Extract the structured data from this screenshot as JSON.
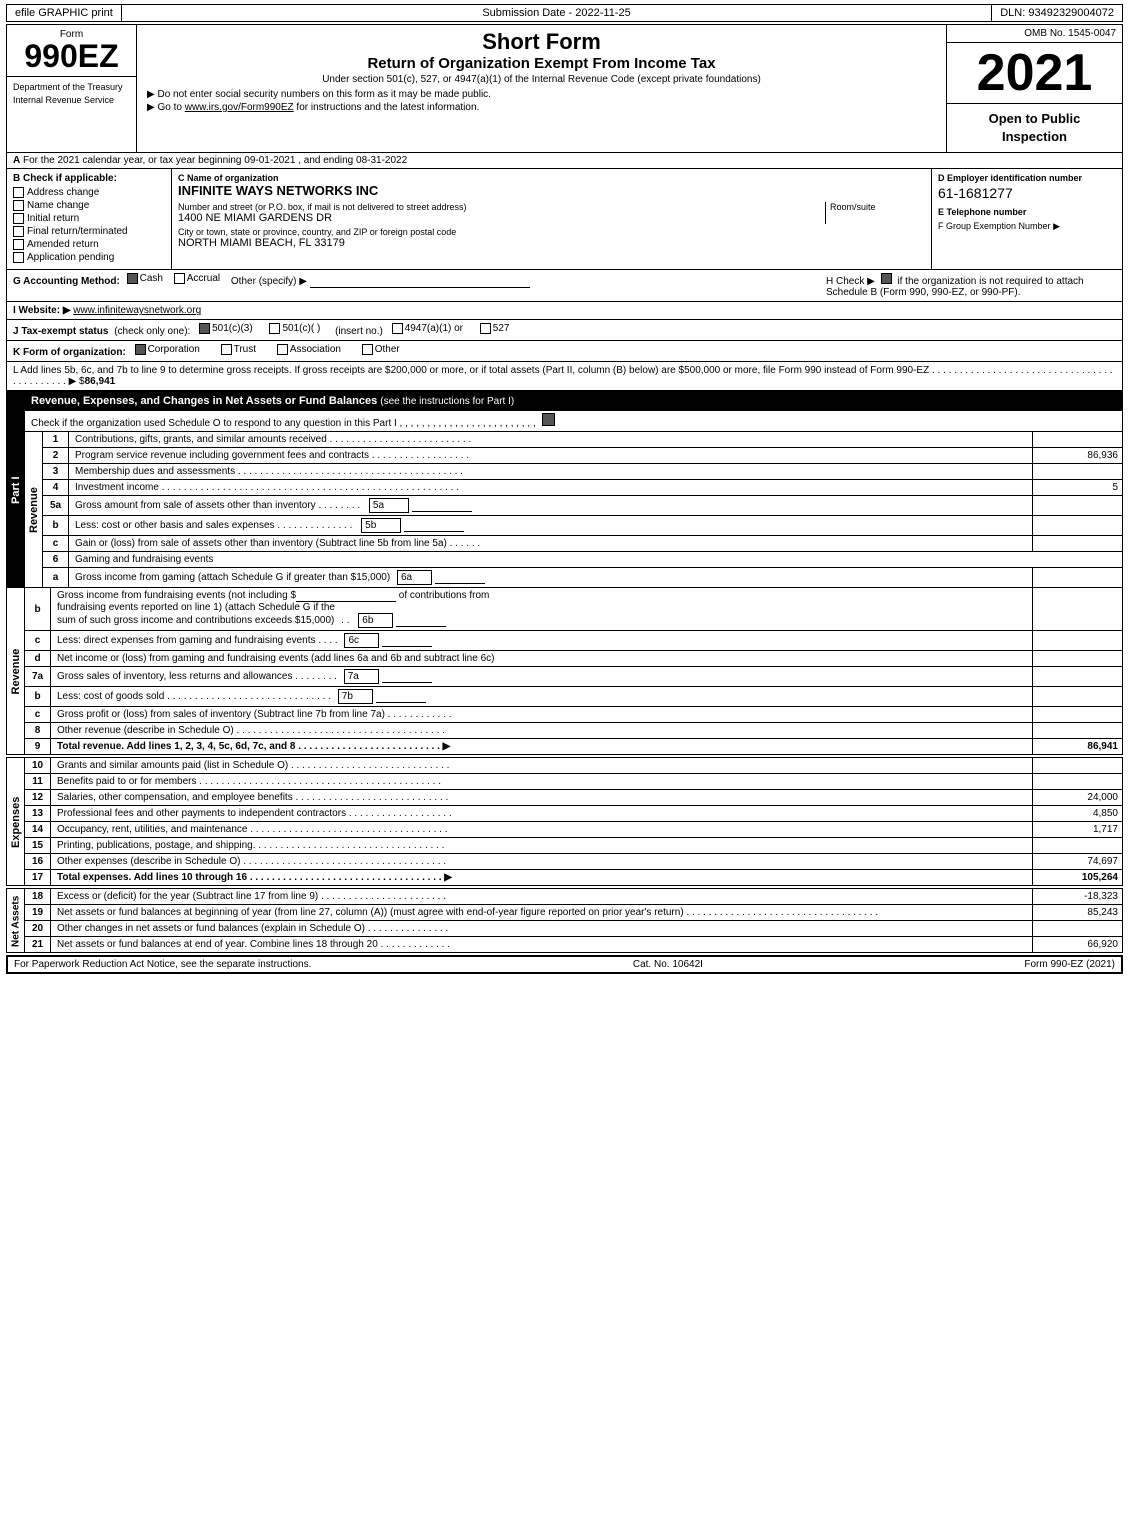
{
  "topBar": {
    "efile": "efile GRAPHIC print",
    "submissionLabel": "Submission Date - 2022-11-25",
    "dlnLabel": "DLN: 93492329004072"
  },
  "header": {
    "ombNo": "OMB No. 1545-0047",
    "formNumber": "990EZ",
    "formSub": "Form",
    "shortForm": "Short Form",
    "returnTitle": "Return of Organization Exempt From Income Tax",
    "subtitle": "Under section 501(c), 527, or 4947(a)(1) of the Internal Revenue Code (except private foundations)",
    "doNotEnter": "▶ Do not enter social security numbers on this form as it may be made public.",
    "goTo": "▶ Go to www.irs.gov/Form990EZ for instructions and the latest information.",
    "year": "2021",
    "openToPublic": "Open to Public Inspection",
    "deptLine1": "Department of the Treasury",
    "deptLine2": "Internal Revenue Service"
  },
  "sectionA": {
    "label": "A",
    "yearText": "For the 2021 calendar year, or tax year beginning 09-01-2021 , and ending 08-31-2022",
    "checkLabel": "B Check if applicable:",
    "checks": [
      {
        "label": "Address change",
        "checked": false
      },
      {
        "label": "Name change",
        "checked": false
      },
      {
        "label": "Initial return",
        "checked": false
      },
      {
        "label": "Final return/terminated",
        "checked": false
      },
      {
        "label": "Amended return",
        "checked": false
      },
      {
        "label": "Application pending",
        "checked": false
      }
    ],
    "cLabel": "C Name of organization",
    "orgName": "INFINITE WAYS NETWORKS INC",
    "streetLabel": "Number and street (or P.O. box, if mail is not delivered to street address)",
    "streetValue": "1400 NE MIAMI GARDENS DR",
    "roomLabel": "Room/suite",
    "cityLabel": "City or town, state or province, country, and ZIP or foreign postal code",
    "cityValue": "NORTH MIAMI BEACH, FL 33179",
    "dLabel": "D Employer identification number",
    "ein": "61-1681277",
    "eLabel": "E Telephone number",
    "fLabel": "F Group Exemption Number",
    "fArrow": "▶"
  },
  "accounting": {
    "gLabel": "G Accounting Method:",
    "cashChecked": true,
    "accrualChecked": false,
    "otherLabel": "Other (specify) ▶",
    "hLabel": "H Check ▶",
    "hCheckChecked": true,
    "hText": "if the organization is not required to attach Schedule B (Form 990, 990-EZ, or 990-PF)."
  },
  "website": {
    "iLabel": "I Website: ▶",
    "url": "www.infinitewaysnetwork.org"
  },
  "taxStatus": {
    "jLabel": "J Tax-exempt status",
    "jNote": "(check only one):",
    "options": [
      {
        "label": "501(c)(3)",
        "checked": true
      },
      {
        "label": "501(c)(  )",
        "checked": false
      },
      {
        "label": "(insert no.)",
        "checked": false
      },
      {
        "label": "4947(a)(1) or",
        "checked": false
      },
      {
        "label": "527",
        "checked": false
      }
    ]
  },
  "formOrg": {
    "kLabel": "K Form of organization:",
    "options": [
      {
        "label": "Corporation",
        "checked": true
      },
      {
        "label": "Trust",
        "checked": false
      },
      {
        "label": "Association",
        "checked": false
      },
      {
        "label": "Other",
        "checked": false
      }
    ]
  },
  "lText": "L Add lines 5b, 6c, and 7b to line 9 to determine gross receipts. If gross receipts are $200,000 or more, or if total assets (Part II, column (B) below) are $500,000 or more, file Form 990 instead of Form 990-EZ . . . . . . . . . . . . . . . . . . . . . . . . . . . . . . . . . . . . . . . . . . . ▶ $",
  "lAmount": "86,941",
  "partI": {
    "title": "Revenue, Expenses, and Changes in Net Assets or Fund Balances",
    "seeInstr": "(see the instructions for Part I)",
    "checkText": "Check if the organization used Schedule O to respond to any question in this Part I , , , , , , , , , , , , , , , , , , , , , , , , ,",
    "revenueLabel": "Revenue",
    "expensesLabel": "Expenses",
    "netAssetsLabel": "Net Assets",
    "lines": [
      {
        "num": "1",
        "label": "Contributions, gifts, grants, and similar amounts received . . . . . . . . . . . . . . . . . . . . . . . . . .",
        "amount": ""
      },
      {
        "num": "2",
        "label": "Program service revenue including government fees and contracts . . . . . . . . . . . . . . . . . .",
        "amount": "86,936"
      },
      {
        "num": "3",
        "label": "Membership dues and assessments . . . . . . . . . . . . . . . . . . . . . . . . . . . . . . . . . . . . . . . . .",
        "amount": ""
      },
      {
        "num": "4",
        "label": "Investment income . . . . . . . . . . . . . . . . . . . . . . . . . . . . . . . . . . . . . . . . . . . . . . . . . . . . . .",
        "amount": "5"
      },
      {
        "num": "5a",
        "label": "Gross amount from sale of assets other than inventory . . . . . . . .",
        "subNum": "5a",
        "subAmount": "",
        "amount": ""
      },
      {
        "num": "b",
        "label": "Less: cost or other basis and sales expenses . . . . . . . . . . . . . .",
        "subNum": "5b",
        "subAmount": "",
        "amount": ""
      },
      {
        "num": "c",
        "label": "Gain or (loss) from sale of assets other than inventory (Subtract line 5b from line 5a) . . . . . .",
        "amount": "",
        "lineRef": "5c"
      },
      {
        "num": "6",
        "label": "Gaming and fundraising events",
        "amount": ""
      },
      {
        "num": "a",
        "label": "Gross income from gaming (attach Schedule G if greater than $15,000)",
        "subNum": "6a",
        "subAmount": "",
        "amount": ""
      },
      {
        "num": "b",
        "label": "Gross income from fundraising events (not including $_______________of contributions from fundraising events reported on line 1) (attach Schedule G if the sum of such gross income and contributions exceeds $15,000) . .",
        "subNum": "6b",
        "subAmount": "",
        "amount": ""
      },
      {
        "num": "c",
        "label": "Less: direct expenses from gaming and fundraising events . . . .",
        "subNum": "6c",
        "subAmount": "",
        "amount": ""
      },
      {
        "num": "d",
        "label": "Net income or (loss) from gaming and fundraising events (add lines 6a and 6b and subtract line 6c)",
        "lineRef": "6d",
        "amount": ""
      },
      {
        "num": "7a",
        "label": "Gross sales of inventory, less returns and allowances . . . . . . . .",
        "subNum": "7a",
        "subAmount": "",
        "amount": ""
      },
      {
        "num": "b",
        "label": "Less: cost of goods sold . . . . . . . . . . . . . . . . . . . . . . . . . . . . . .",
        "subNum": "7b",
        "subAmount": "",
        "amount": ""
      },
      {
        "num": "c",
        "label": "Gross profit or (loss) from sales of inventory (Subtract line 7b from line 7a) . . . . . . . . . . . .",
        "lineRef": "7c",
        "amount": ""
      },
      {
        "num": "8",
        "label": "Other revenue (describe in Schedule O) . . . . . . . . . . . . . . . . . . . . . . . . . . . . . . . . . . . . . .",
        "amount": ""
      },
      {
        "num": "9",
        "label": "Total revenue. Add lines 1, 2, 3, 4, 5c, 6d, 7c, and 8 . . . . . . . . . . . . . . . . . . . . . . . . . . ▶",
        "amount": "86,941",
        "bold": true
      }
    ],
    "expenseLines": [
      {
        "num": "10",
        "label": "Grants and similar amounts paid (list in Schedule O) . . . . . . . . . . . . . . . . . . . . . . . . . . . . .",
        "amount": ""
      },
      {
        "num": "11",
        "label": "Benefits paid to or for members . . . . . . . . . . . . . . . . . . . . . . . . . . . . . . . . . . . . . . . . . . . .",
        "amount": ""
      },
      {
        "num": "12",
        "label": "Salaries, other compensation, and employee benefits . . . . . . . . . . . . . . . . . . . . . . . . . . . .",
        "amount": "24,000"
      },
      {
        "num": "13",
        "label": "Professional fees and other payments to independent contractors . . . . . . . . . . . . . . . . . . .",
        "amount": "4,850"
      },
      {
        "num": "14",
        "label": "Occupancy, rent, utilities, and maintenance . . . . . . . . . . . . . . . . . . . . . . . . . . . . . . . . . . . .",
        "amount": "1,717"
      },
      {
        "num": "15",
        "label": "Printing, publications, postage, and shipping. . . . . . . . . . . . . . . . . . . . . . . . . . . . . . . . . . .",
        "amount": ""
      },
      {
        "num": "16",
        "label": "Other expenses (describe in Schedule O) . . . . . . . . . . . . . . . . . . . . . . . . . . . . . . . . . . . . .",
        "amount": "74,697"
      },
      {
        "num": "17",
        "label": "Total expenses. Add lines 10 through 16 . . . . . . . . . . . . . . . . . . . . . . . . . . . . . . . . . . . ▶",
        "amount": "105,264",
        "bold": true
      }
    ],
    "netAssetsLines": [
      {
        "num": "18",
        "label": "Excess or (deficit) for the year (Subtract line 17 from line 9) . . . . . . . . . . . . . . . . . . . . . . .",
        "amount": "-18,323"
      },
      {
        "num": "19",
        "label": "Net assets or fund balances at beginning of year (from line 27, column (A)) (must agree with end-of-year figure reported on prior year's return) . . . . . . . . . . . . . . . . . . . . . . . . . . . . . . . . . . .",
        "amount": "85,243"
      },
      {
        "num": "20",
        "label": "Other changes in net assets or fund balances (explain in Schedule O) . . . . . . . . . . . . . . .",
        "amount": ""
      },
      {
        "num": "21",
        "label": "Net assets or fund balances at end of year. Combine lines 18 through 20 . . . . . . . . . . . . .",
        "amount": "66,920",
        "bold": true
      }
    ]
  },
  "footer": {
    "paperwork": "For Paperwork Reduction Act Notice, see the separate instructions.",
    "catNo": "Cat. No. 10642I",
    "formRef": "Form 990-EZ (2021)"
  }
}
